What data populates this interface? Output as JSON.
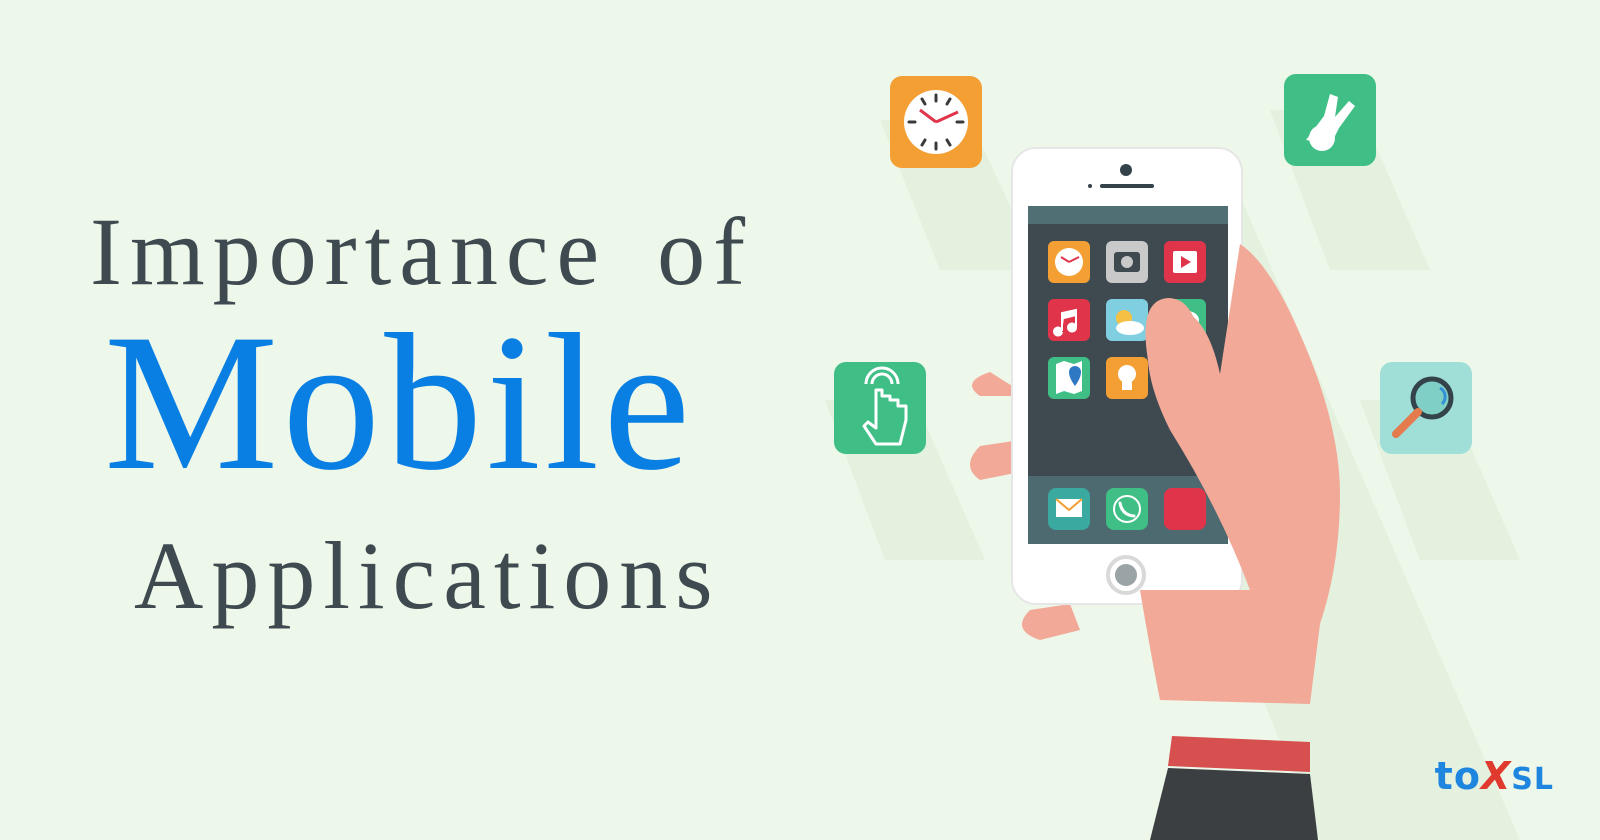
{
  "headline": {
    "line1": "Importance  of",
    "line2": "Mobile",
    "line3": "Applications"
  },
  "logo": {
    "part1": "to",
    "part2": "X",
    "part3": "SL"
  },
  "colors": {
    "background": "#edf7ea",
    "headline_dark": "#3e4a50",
    "headline_accent": "#0a7fe3",
    "logo_blue": "#1f86e0",
    "logo_red": "#e03a2f"
  },
  "icons": [
    "clock-icon",
    "hand-gesture-icon",
    "touch-icon",
    "magnifier-icon",
    "smartphone-icon",
    "hand-icon"
  ]
}
